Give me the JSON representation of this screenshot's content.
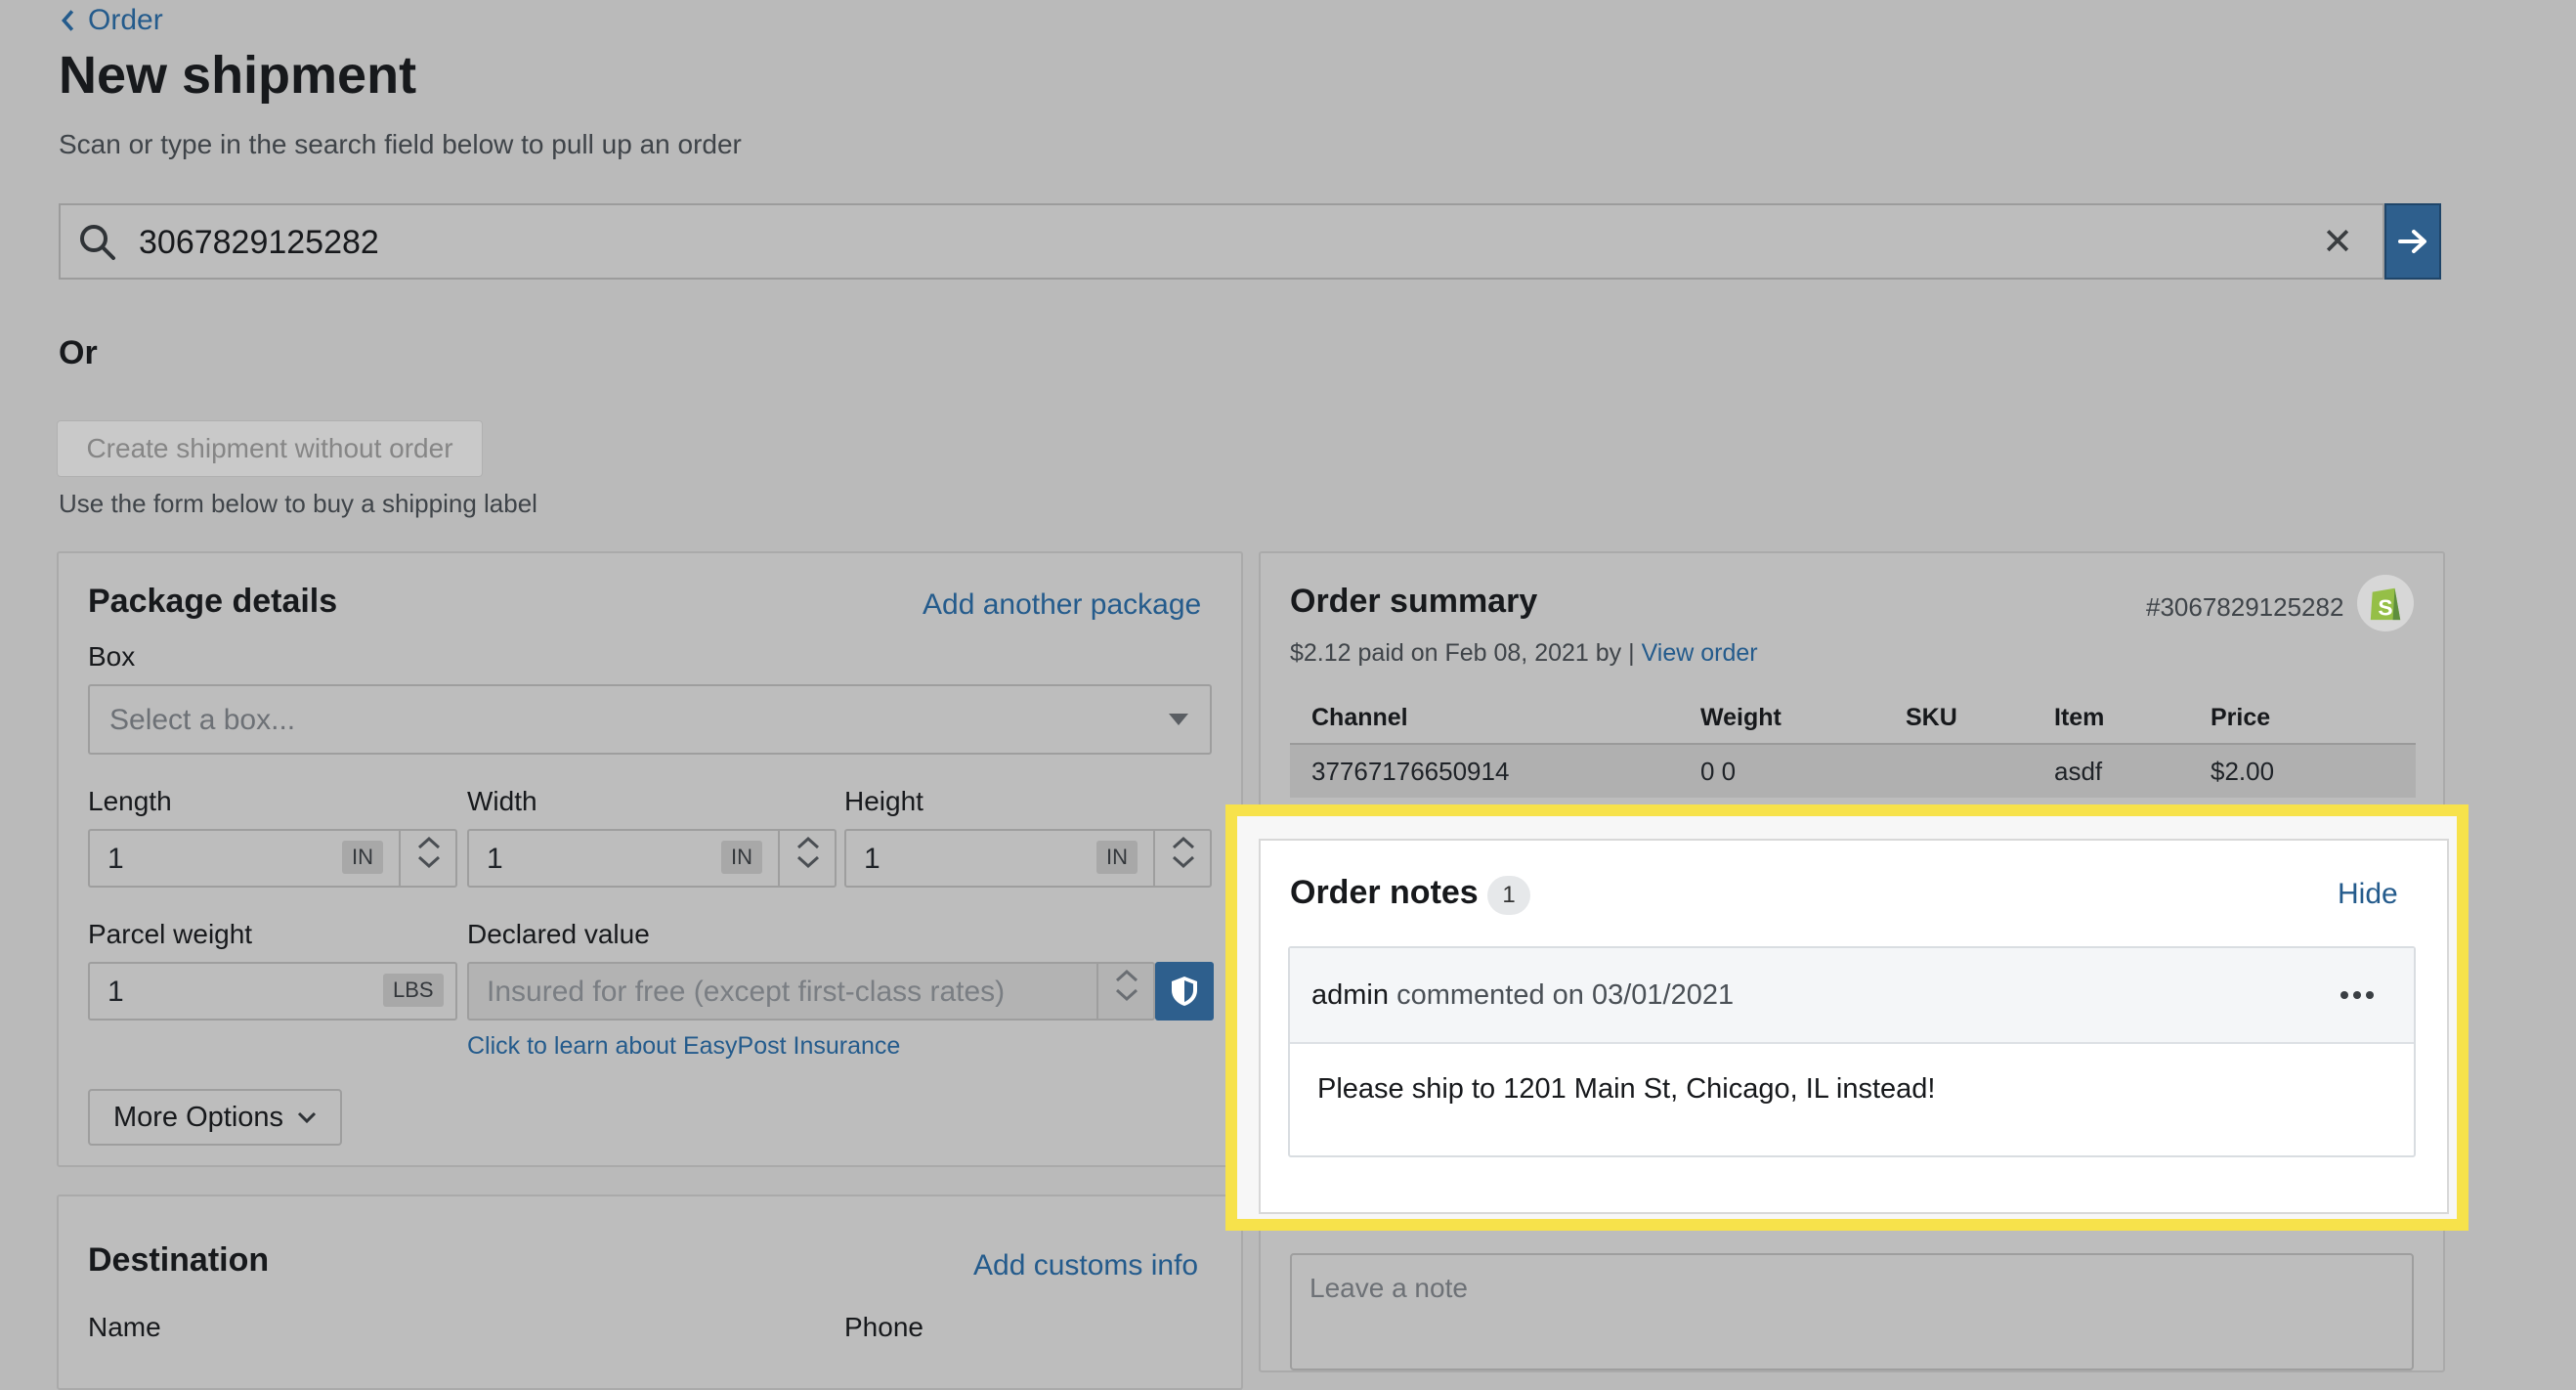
{
  "header": {
    "back_label": "Order",
    "title": "New shipment",
    "subtitle": "Scan or type in the search field below to pull up an order"
  },
  "search": {
    "value": "3067829125282",
    "clear_label": "✕"
  },
  "or_label": "Or",
  "create_button_label": "Create shipment without order",
  "create_hint": "Use the form below to buy a shipping label",
  "package": {
    "title": "Package details",
    "add_link": "Add another package",
    "box_label": "Box",
    "box_placeholder": "Select a box...",
    "length_label": "Length",
    "length_value": "1",
    "width_label": "Width",
    "width_value": "1",
    "height_label": "Height",
    "height_value": "1",
    "dim_unit": "IN",
    "weight_label": "Parcel weight",
    "weight_value": "1",
    "weight_unit": "LBS",
    "declared_label": "Declared value",
    "declared_placeholder": "Insured for free (except first-class rates)",
    "insurance_link": "Click to learn about EasyPost Insurance",
    "more_options_label": "More Options"
  },
  "destination": {
    "title": "Destination",
    "customs_link": "Add customs info",
    "name_label": "Name",
    "phone_label": "Phone"
  },
  "order_summary": {
    "title": "Order summary",
    "order_number": "#3067829125282",
    "paid_text": "$2.12 paid on Feb 08, 2021 by |",
    "view_order_link": "View order",
    "columns": [
      "Channel",
      "Weight",
      "SKU",
      "Item",
      "Price"
    ],
    "rows": [
      {
        "channel": "37767176650914",
        "weight": "0 0",
        "sku": "",
        "item": "asdf",
        "price": "$2.00"
      }
    ]
  },
  "order_notes": {
    "title": "Order notes",
    "count": "1",
    "hide_label": "Hide",
    "comment_author": "admin",
    "comment_meta": "commented on 03/01/2021",
    "comment_body": "Please ship to 1201 Main St, Chicago, IL instead!",
    "leave_note_placeholder": "Leave a note"
  },
  "colors": {
    "accent": "#245b8c",
    "highlight": "#f7e24b",
    "shopify_green": "#95bf47"
  }
}
